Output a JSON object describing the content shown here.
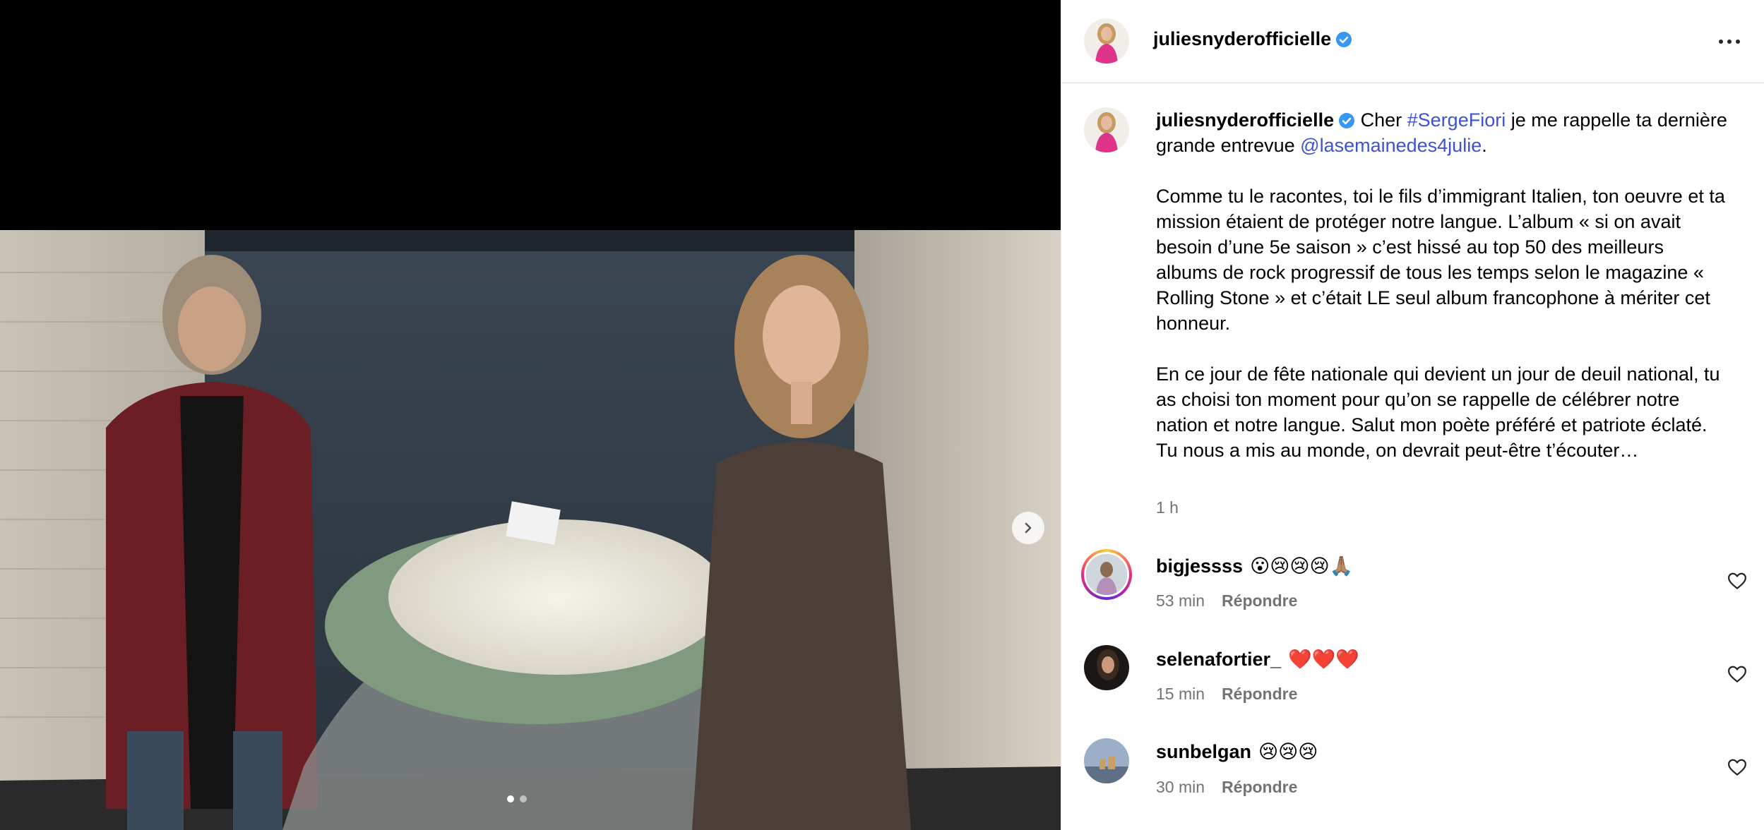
{
  "post": {
    "username": "juliesnyderofficielle",
    "verified_icon": "verified-badge-icon",
    "more_icon": "more-options-icon",
    "media": {
      "image_description": "photo",
      "carousel_total": 2,
      "carousel_active": 1,
      "next_icon": "chevron-right-icon"
    }
  },
  "caption": {
    "username": "juliesnyderofficielle",
    "lead": "Cher ",
    "hashtag": "#SergeFiori",
    "mid": " je me rappelle ta dernière grande entrevue ",
    "mention": "@lasemainedes4julie",
    "end": ".",
    "para2": "Comme tu le racontes, toi le fils d’immigrant Italien, ton oeuvre et ta mission étaient de protéger notre langue. L’album « si on avait besoin d’une 5e saison » c’est hissé au top 50 des meilleurs albums de rock progressif de tous les temps selon le magazine « Rolling Stone » et c’était LE seul album francophone à mériter cet honneur.",
    "para3": "En ce jour de fête nationale qui devient un jour de deuil national, tu as choisi ton moment pour qu’on se rappelle de célébrer notre nation et notre langue. Salut mon poète préféré et patriote éclaté. Tu nous a mis au monde, on devrait peut-être t’écouter…",
    "time": "1 h"
  },
  "comments": [
    {
      "username": "bigjessss",
      "text": "😮😢😢😢🙏🏽",
      "time": "53 min",
      "reply_label": "Répondre",
      "like_icon": "heart-outline-icon"
    },
    {
      "username": "selenafortier_",
      "text": "❤️❤️❤️",
      "time": "15 min",
      "reply_label": "Répondre",
      "like_icon": "heart-outline-icon"
    },
    {
      "username": "sunbelgan",
      "text": "😢😢😢",
      "time": "30 min",
      "reply_label": "Répondre",
      "like_icon": "heart-outline-icon"
    }
  ],
  "colors": {
    "link": "#3f51d6",
    "verified": "#3897f0",
    "meta": "#737373"
  }
}
